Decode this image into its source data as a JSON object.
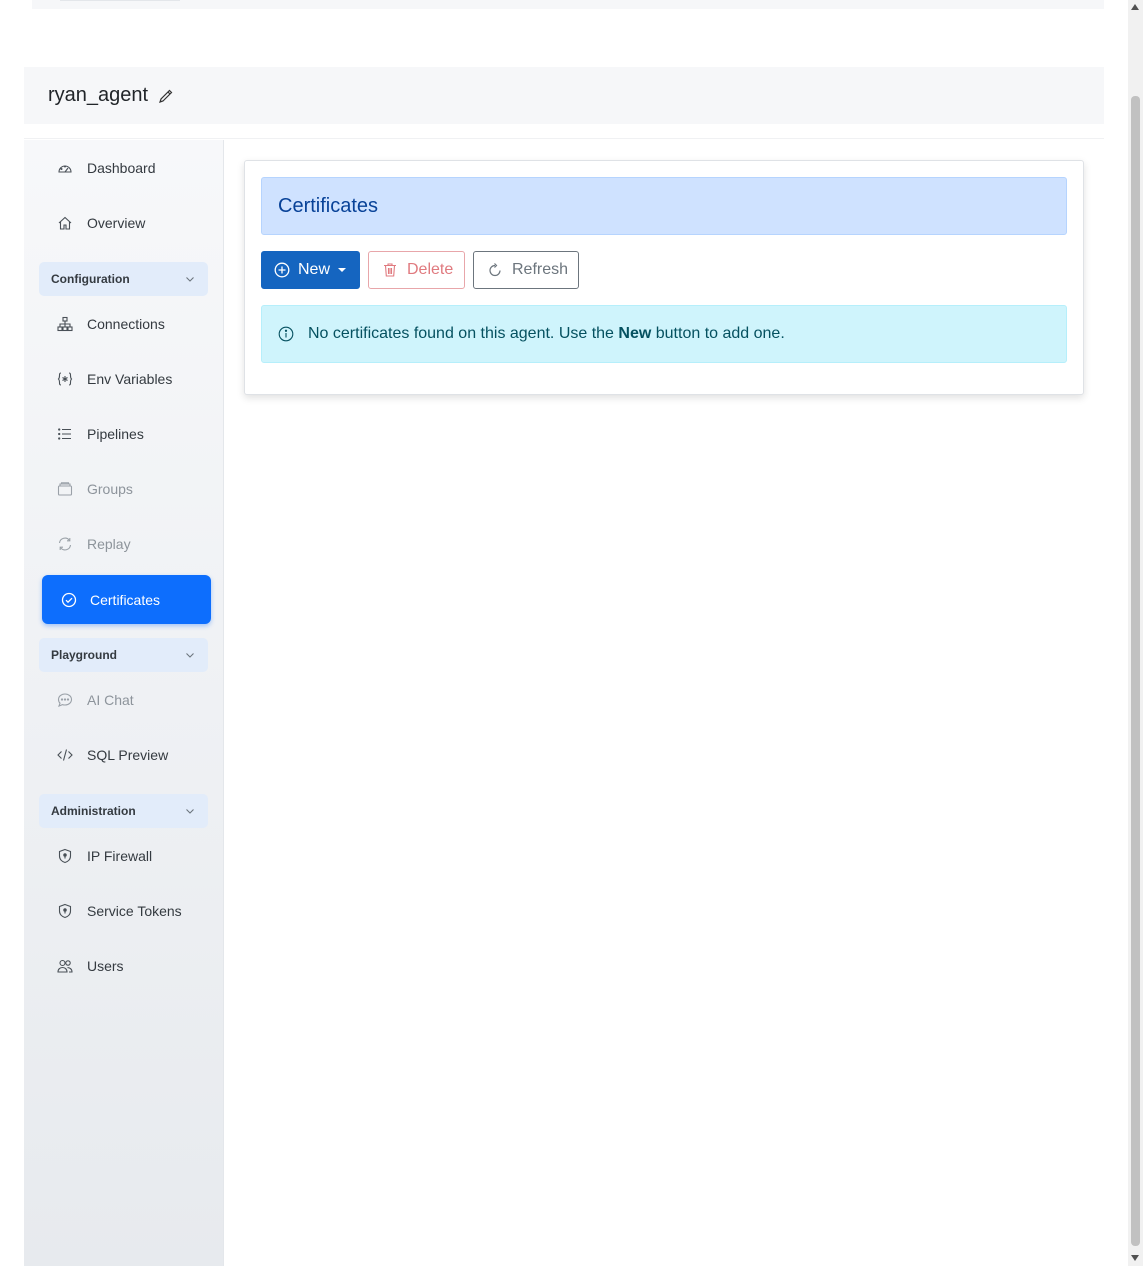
{
  "header": {
    "title": "ryan_agent"
  },
  "sidebar": {
    "items": [
      {
        "label": "Dashboard",
        "icon": "dashboard-gauge-icon"
      },
      {
        "label": "Overview",
        "icon": "home-icon"
      }
    ],
    "sections": {
      "configuration": {
        "label": "Configuration",
        "items": [
          {
            "label": "Connections",
            "icon": "diagram-icon"
          },
          {
            "label": "Env Variables",
            "icon": "braces-asterisk-icon"
          },
          {
            "label": "Pipelines",
            "icon": "list-icon"
          },
          {
            "label": "Groups",
            "icon": "archive-icon",
            "disabled": true
          },
          {
            "label": "Replay",
            "icon": "repeat-icon",
            "disabled": true
          },
          {
            "label": "Certificates",
            "icon": "patch-check-icon",
            "active": true
          }
        ]
      },
      "playground": {
        "label": "Playground",
        "items": [
          {
            "label": "AI Chat",
            "icon": "chat-dots-icon",
            "disabled": true
          },
          {
            "label": "SQL Preview",
            "icon": "code-slash-icon"
          }
        ]
      },
      "administration": {
        "label": "Administration",
        "items": [
          {
            "label": "IP Firewall",
            "icon": "shield-icon"
          },
          {
            "label": "Service Tokens",
            "icon": "shield-icon"
          },
          {
            "label": "Users",
            "icon": "people-icon"
          }
        ]
      }
    }
  },
  "main": {
    "card_title": "Certificates",
    "toolbar": {
      "new_label": "New",
      "delete_label": "Delete",
      "refresh_label": "Refresh"
    },
    "alert": {
      "text_before": "No certificates found on this agent. Use the ",
      "bold": "New",
      "text_after": " button to add one."
    }
  },
  "colors": {
    "primary": "#0d6efd",
    "new_button": "#1565c0",
    "title_bg": "#cfe2ff",
    "alert_bg": "#cff4fc",
    "delete": "#e07a7f"
  }
}
